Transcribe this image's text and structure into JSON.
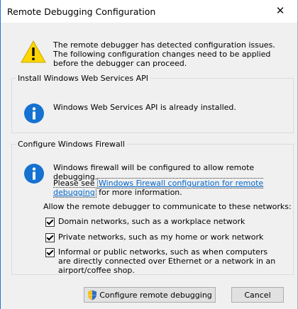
{
  "window": {
    "title": "Remote Debugging Configuration",
    "close_glyph": "✕"
  },
  "warning": {
    "icon": "warning-icon",
    "text": "The remote debugger has detected configuration issues. The following configuration changes need to be applied before the debugger can proceed."
  },
  "web_services": {
    "legend": "Install Windows Web Services API",
    "icon": "info-icon",
    "message": "Windows Web Services API is already installed."
  },
  "firewall": {
    "legend": "Configure Windows Firewall",
    "icon": "info-icon",
    "message": "Windows firewall will be configured to allow remote debugging.",
    "see_prefix": "Please see ",
    "link_text": "Windows Firewall configuration for remote debugging",
    "see_suffix": " for more information.",
    "networks_intro": "Allow the remote debugger to communicate to these networks:",
    "networks": [
      {
        "label": "Domain networks, such as a workplace network",
        "checked": true
      },
      {
        "label": "Private networks, such as my home or work network",
        "checked": true
      },
      {
        "label": "Informal or public networks, such as when computers are directly connected over Ethernet or a network in an airport/coffee shop.",
        "checked": true
      }
    ]
  },
  "buttons": {
    "configure_label": "Configure remote debugging",
    "configure_icon": "shield-icon",
    "cancel_label": "Cancel"
  },
  "colors": {
    "accent": "#1e78d6",
    "info_blue": "#1572d0",
    "warning_yellow": "#ffd600"
  }
}
